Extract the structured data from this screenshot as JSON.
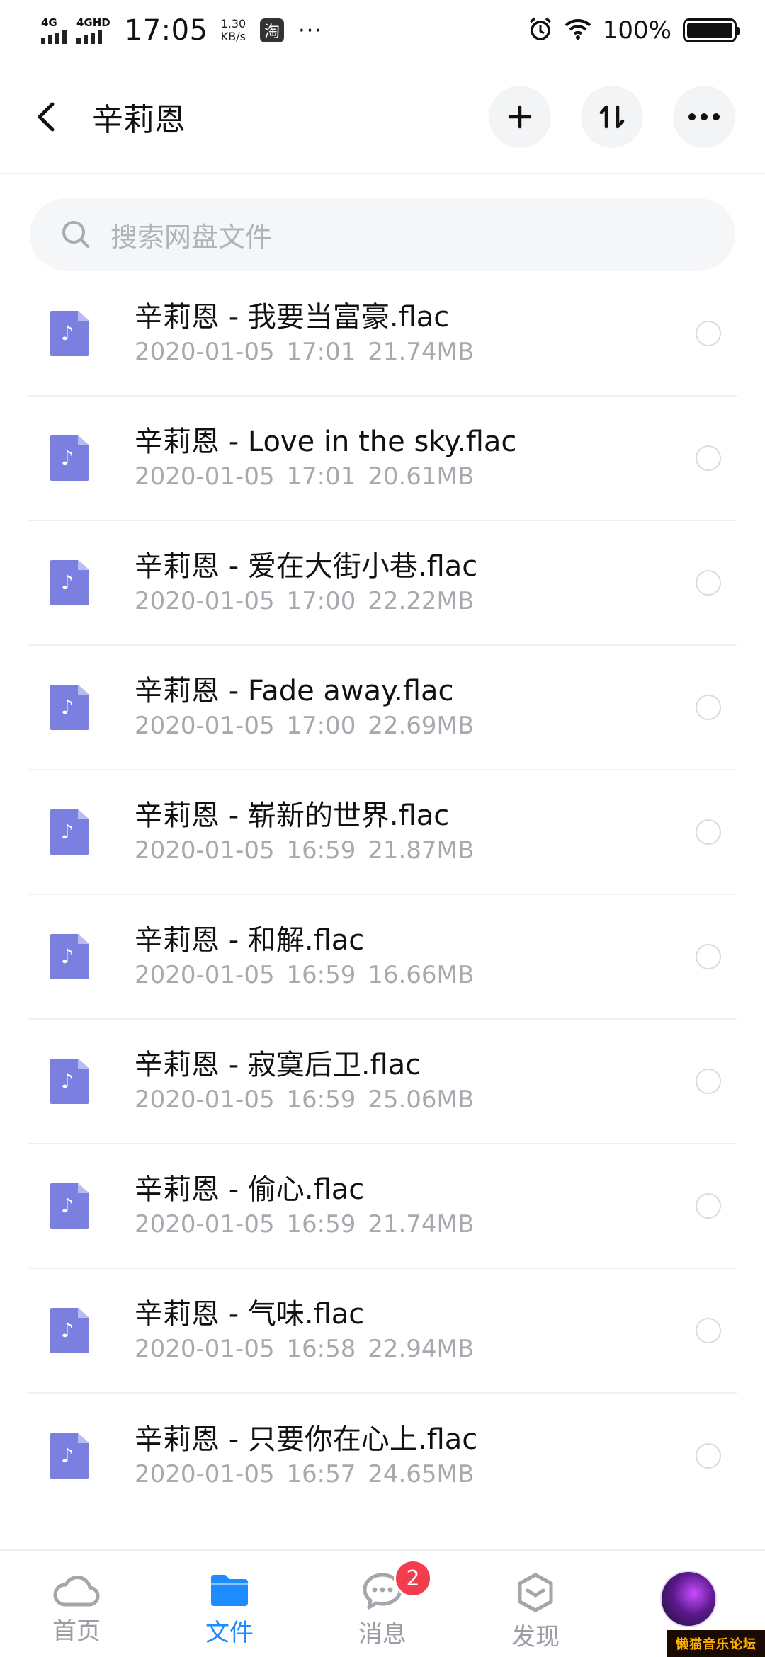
{
  "status_bar": {
    "net1": "4G",
    "net2": "4GHD",
    "time": "17:05",
    "speed_value": "1.30",
    "speed_unit": "KB/s",
    "notif_icon": "淘",
    "more": "···",
    "battery": "100%"
  },
  "header": {
    "title": "辛莉恩"
  },
  "search": {
    "placeholder": "搜索网盘文件"
  },
  "files": [
    {
      "name": "辛莉恩 - 我要当富豪.flac",
      "date": "2020-01-05",
      "time": "17:01",
      "size": "21.74MB"
    },
    {
      "name": "辛莉恩 - Love in the sky.flac",
      "date": "2020-01-05",
      "time": "17:01",
      "size": "20.61MB"
    },
    {
      "name": "辛莉恩 - 爱在大街小巷.flac",
      "date": "2020-01-05",
      "time": "17:00",
      "size": "22.22MB"
    },
    {
      "name": "辛莉恩 - Fade away.flac",
      "date": "2020-01-05",
      "time": "17:00",
      "size": "22.69MB"
    },
    {
      "name": "辛莉恩 - 崭新的世界.flac",
      "date": "2020-01-05",
      "time": "16:59",
      "size": "21.87MB"
    },
    {
      "name": "辛莉恩 - 和解.flac",
      "date": "2020-01-05",
      "time": "16:59",
      "size": "16.66MB"
    },
    {
      "name": "辛莉恩 - 寂寞后卫.flac",
      "date": "2020-01-05",
      "time": "16:59",
      "size": "25.06MB"
    },
    {
      "name": "辛莉恩 - 偷心.flac",
      "date": "2020-01-05",
      "time": "16:59",
      "size": "21.74MB"
    },
    {
      "name": "辛莉恩 - 气味.flac",
      "date": "2020-01-05",
      "time": "16:58",
      "size": "22.94MB"
    },
    {
      "name": "辛莉恩 - 只要你在心上.flac",
      "date": "2020-01-05",
      "time": "16:57",
      "size": "24.65MB"
    }
  ],
  "nav": {
    "home": "首页",
    "files": "文件",
    "messages": "消息",
    "messages_badge": "2",
    "discover": "发现"
  },
  "watermark": "懒猫音乐论坛",
  "colors": {
    "accent": "#1e8cff",
    "file_icon": "#7b7fe0",
    "badge": "#f33d4f"
  }
}
